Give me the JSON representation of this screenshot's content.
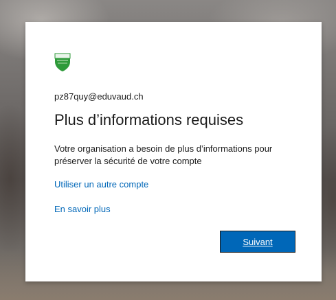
{
  "account": {
    "email": "pz87quy@eduvaud.ch"
  },
  "dialog": {
    "title": "Plus d’informations requises",
    "description": "Votre organisation a besoin de plus d’informations pour préserver la sécurité de votre compte",
    "use_other_account_link": "Utiliser un autre compte",
    "learn_more_link": "En savoir plus",
    "next_button": "Suivant"
  },
  "logo": {
    "icon": "shield-crest-icon",
    "color": "#2e9a3a"
  },
  "colors": {
    "link": "#0067b8",
    "button_bg": "#0067b8",
    "text": "#1b1b1b",
    "card_bg": "#ffffff"
  }
}
